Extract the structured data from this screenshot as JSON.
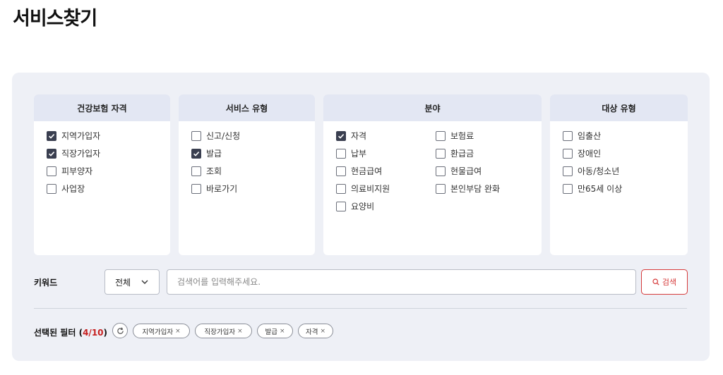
{
  "page": {
    "title": "서비스찾기"
  },
  "filters": {
    "eligibility": {
      "header": "건강보험 자격",
      "options": [
        {
          "label": "지역가입자",
          "checked": true
        },
        {
          "label": "직장가입자",
          "checked": true
        },
        {
          "label": "피부양자",
          "checked": false
        },
        {
          "label": "사업장",
          "checked": false
        }
      ]
    },
    "service_type": {
      "header": "서비스 유형",
      "options": [
        {
          "label": "신고/신청",
          "checked": false
        },
        {
          "label": "발급",
          "checked": true
        },
        {
          "label": "조회",
          "checked": false
        },
        {
          "label": "바로가기",
          "checked": false
        }
      ]
    },
    "field": {
      "header": "분야",
      "options": [
        {
          "label": "자격",
          "checked": true
        },
        {
          "label": "보험료",
          "checked": false
        },
        {
          "label": "납부",
          "checked": false
        },
        {
          "label": "환급금",
          "checked": false
        },
        {
          "label": "현금급여",
          "checked": false
        },
        {
          "label": "현물급여",
          "checked": false
        },
        {
          "label": "의료비지원",
          "checked": false
        },
        {
          "label": "본인부담 완화",
          "checked": false
        },
        {
          "label": "요양비",
          "checked": false
        }
      ]
    },
    "target_type": {
      "header": "대상 유형",
      "options": [
        {
          "label": "임출산",
          "checked": false
        },
        {
          "label": "장애인",
          "checked": false
        },
        {
          "label": "아동/청소년",
          "checked": false
        },
        {
          "label": "만65세 이상",
          "checked": false
        }
      ]
    }
  },
  "keyword": {
    "label": "키워드",
    "scope_selected": "전체",
    "input_value": "",
    "placeholder": "검색어를 입력해주세요.",
    "search_label": "검색"
  },
  "selected": {
    "label": "선택된 필터",
    "count": "4",
    "max": "10",
    "remove_glyph": "×",
    "chips": [
      "지역가입자",
      "직장가입자",
      "발급",
      "자격"
    ]
  },
  "colors": {
    "accent": "#d63a3a",
    "panel_bg": "#eef0f6",
    "header_bg": "#e3e7f3",
    "checked": "#3a3f50"
  },
  "icons": {
    "reset": "refresh-icon",
    "search": "search-icon",
    "dropdown": "chevron-down-icon",
    "check": "check-icon"
  }
}
